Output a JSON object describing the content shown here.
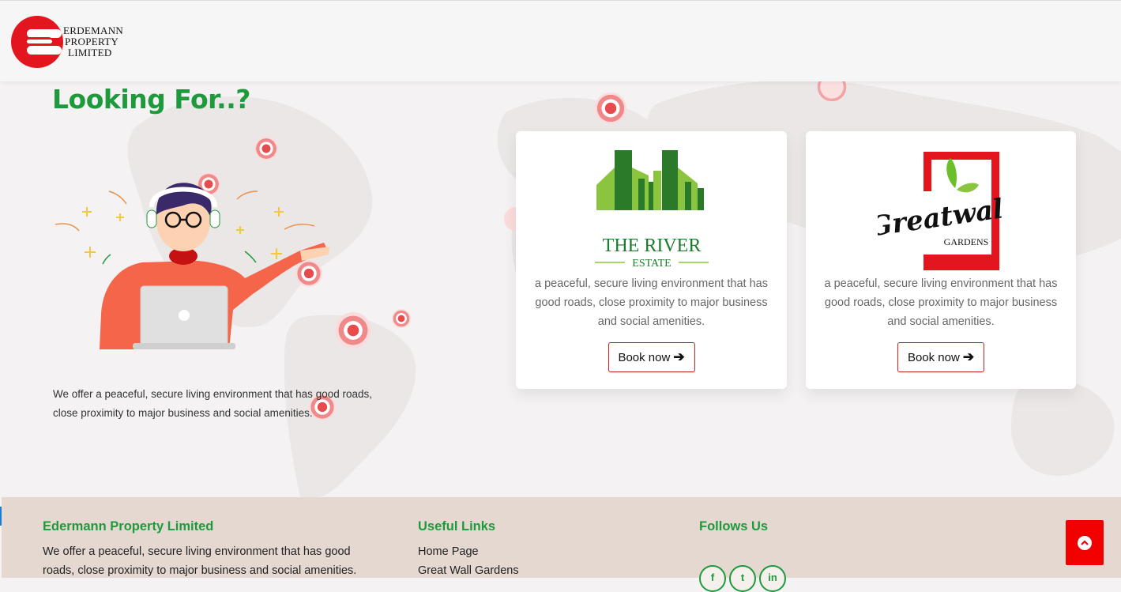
{
  "header": {
    "logo_line1": "ERDEMANN",
    "logo_line2": "PROPERTY",
    "logo_line3": "LIMITED"
  },
  "hero": {
    "heading": "Looking For..?",
    "description": "We offer a peaceful, secure living environment that has good roads, close proximity to major business and social amenities."
  },
  "cards": [
    {
      "logo_title": "THE RIVER",
      "logo_subtitle": "ESTATE",
      "text": "a peaceful, secure living environment that has good roads, close proximity to major business and social amenities.",
      "button": "Book now"
    },
    {
      "logo_title": "Greatwall",
      "logo_subtitle": "GARDENS",
      "text": "a peaceful, secure living environment that has good roads, close proximity to major business and social amenities.",
      "button": "Book now"
    }
  ],
  "footer": {
    "company_title": "Edermann Property Limited",
    "company_text": "We offer a peaceful, secure living environment that has good roads, close proximity to major business and social amenities.",
    "links_title": "Useful Links",
    "links": [
      "Home Page",
      "Great Wall Gardens"
    ],
    "follow_title": "Follows Us",
    "socials": [
      {
        "icon": "facebook-icon",
        "glyph": "f"
      },
      {
        "icon": "twitter-icon",
        "glyph": "t"
      },
      {
        "icon": "linkedin-icon",
        "glyph": "in"
      }
    ]
  },
  "colors": {
    "brand_red": "#e3161f",
    "brand_green": "#1e9a3c",
    "button_border": "#c81a1a",
    "footer_bg": "#e4d8d0",
    "scroll_top_bg": "#f20000"
  }
}
